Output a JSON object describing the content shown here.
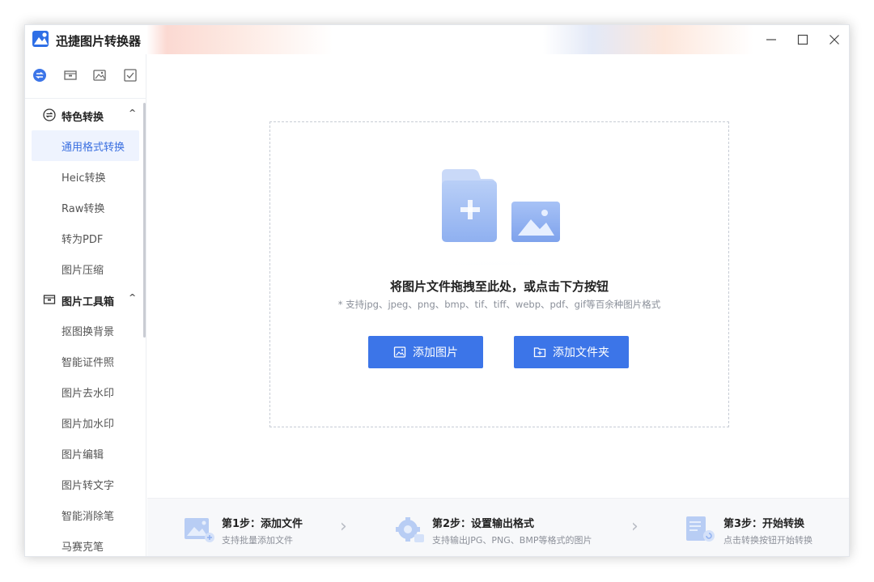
{
  "app": {
    "title": "迅捷图片转换器"
  },
  "sidebar": {
    "top_icons": [
      "convert-icon",
      "toolbox-icon",
      "image-icon",
      "check-box-icon"
    ],
    "sections": [
      {
        "label": "特色转换",
        "icon": "convert-icon",
        "items": [
          "通用格式转换",
          "Heic转换",
          "Raw转换",
          "转为PDF",
          "图片压缩"
        ]
      },
      {
        "label": "图片工具箱",
        "icon": "toolbox-icon",
        "items": [
          "抠图换背景",
          "智能证件照",
          "图片去水印",
          "图片加水印",
          "图片编辑",
          "图片转文字",
          "智能消除笔",
          "马赛克笔"
        ]
      }
    ],
    "active_item": "通用格式转换",
    "caret": "^"
  },
  "main": {
    "drop_title": "将图片文件拖拽至此处，或点击下方按钮",
    "drop_subtitle": "* 支持jpg、jpeg、png、bmp、tif、tiff、webp、pdf、gif等百余种图片格式",
    "add_image_label": "添加图片",
    "add_folder_label": "添加文件夹"
  },
  "steps": [
    {
      "title": "第1步：添加文件",
      "desc": "支持批量添加文件"
    },
    {
      "title": "第2步：设置输出格式",
      "desc": "支持输出JPG、PNG、BMP等格式的图片"
    },
    {
      "title": "第3步：开始转换",
      "desc": "点击转换按钮开始转换"
    }
  ],
  "colors": {
    "accent": "#3c75e8",
    "active_bg": "#eef3fe",
    "active_text": "#3a6fe0"
  }
}
